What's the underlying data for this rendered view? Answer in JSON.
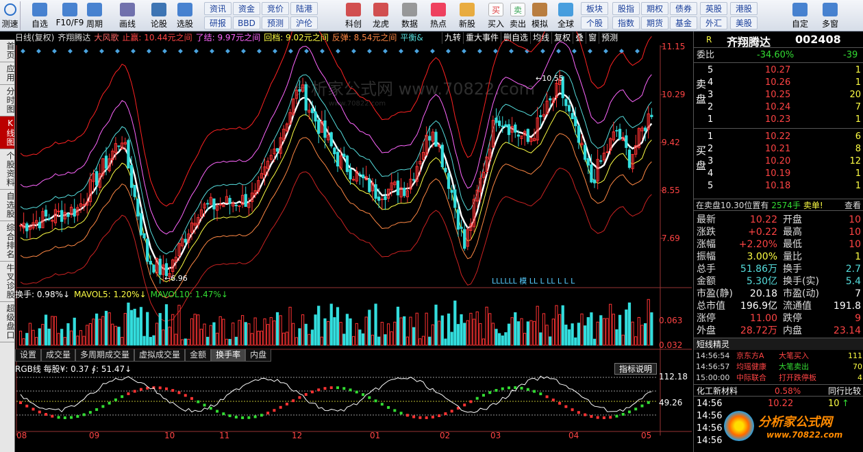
{
  "toolbar": {
    "buttons": [
      {
        "label": "自选",
        "icon": "star-icon"
      },
      {
        "label": "F10/F9",
        "icon": "f10-icon"
      },
      {
        "label": "周期",
        "icon": "clock-icon"
      },
      {
        "label": "画线",
        "icon": "pencil-icon"
      },
      {
        "label": "论股",
        "icon": "forum-icon"
      },
      {
        "label": "选股",
        "icon": "stock-picker-icon"
      },
      {
        "label": "科创",
        "icon": "kechuang-icon"
      },
      {
        "label": "龙虎",
        "icon": "dragon-tiger-icon"
      },
      {
        "label": "数据",
        "icon": "pe-data-icon"
      },
      {
        "label": "热点",
        "icon": "hotspot-icon"
      },
      {
        "label": "新股",
        "icon": "ipo-icon"
      },
      {
        "label": "买入",
        "icon": "buy-icon"
      },
      {
        "label": "卖出",
        "icon": "sell-icon"
      },
      {
        "label": "模拟",
        "icon": "hammer-icon"
      },
      {
        "label": "全球",
        "icon": "globe-icon"
      },
      {
        "label": "自定",
        "icon": "custom-icon"
      },
      {
        "label": "多窗",
        "icon": "multi-window-icon"
      }
    ],
    "mini_row1": [
      "资讯",
      "资金",
      "竞价",
      "陆港",
      "板块",
      "股指",
      "期权",
      "债券",
      "英股",
      "港股"
    ],
    "mini_row2": [
      "研报",
      "BBD",
      "预测",
      "沪伦",
      "个股",
      "指数",
      "期货",
      "基金",
      "外汇",
      "美股"
    ],
    "corner_label": "测速",
    "buy_glyph": "买",
    "sell_glyph": "卖"
  },
  "sidebar": {
    "tabs": [
      "首页",
      "应用",
      "分时图",
      "K线图",
      "个股资料",
      "自选股",
      "综合排名",
      "牛叉诊股",
      "超级盘口"
    ],
    "active": "K线图"
  },
  "chart": {
    "info": [
      {
        "text": "日线(复权)",
        "color": "#dddddd"
      },
      {
        "text": "齐翔腾达",
        "color": "#dddddd"
      },
      {
        "text": "大风歌",
        "color": "#ff6666"
      },
      {
        "text": "止赢: 10.44元之间",
        "color": "#ff4444"
      },
      {
        "text": "了结: 9.97元之间",
        "color": "#ff66ff"
      },
      {
        "text": "回档: 9.02元之间",
        "color": "#ffff44"
      },
      {
        "text": "反弹: 8.54元之间",
        "color": "#ff8844"
      },
      {
        "text": "平衡&",
        "color": "#55dddd"
      }
    ],
    "tools": [
      "九转",
      "重大事件",
      "删自选",
      "均线",
      "复权",
      "叠",
      "窗",
      "预测"
    ],
    "price_axis": [
      "11.15",
      "10.29",
      "9.42",
      "8.55",
      "7.69"
    ],
    "high_mark": "10.55",
    "low_mark": "6.96",
    "watermark": "分析家公式网 www.70822.com",
    "watermark_sub": "www.70822.com",
    "event_marks": "LLLLLL 模 LL L    LL L  L L"
  },
  "volume": {
    "info": [
      {
        "text": "换手: 0.98%↓",
        "color": "#ffffff"
      },
      {
        "text": "MAVOL5: 1.20%↓",
        "color": "#ffff44"
      },
      {
        "text": "MAVOL10: 1.47%↓",
        "color": "#33dd33"
      }
    ],
    "axis": [
      "0.063",
      "0.032"
    ]
  },
  "subtabs": {
    "items": [
      "设置",
      "成交量",
      "多周期成交量",
      "虚拟成交量",
      "金额",
      "换手率",
      "内盘"
    ],
    "active": "换手率"
  },
  "indicator": {
    "info": "RGB线 每股¥: 0.37  ∮: 51.47↓",
    "help_label": "指标说明",
    "axis": [
      "112.18",
      "49.26"
    ]
  },
  "time_axis": [
    "08",
    "09",
    "10",
    "11",
    "12",
    "01",
    "02",
    "03",
    "04",
    "05"
  ],
  "right_panel": {
    "stock_name": "齐翔腾达",
    "stock_code": "002408",
    "webi_label": "委比",
    "webi_value": "-34.60%",
    "webi_diff": "-39",
    "sell_label": [
      "卖",
      "盘"
    ],
    "buy_label": [
      "买",
      "盘"
    ],
    "sell": [
      {
        "n": "5",
        "p": "10.27",
        "v": "1"
      },
      {
        "n": "4",
        "p": "10.26",
        "v": "1"
      },
      {
        "n": "3",
        "p": "10.25",
        "v": "20"
      },
      {
        "n": "2",
        "p": "10.24",
        "v": "7"
      },
      {
        "n": "1",
        "p": "10.23",
        "v": "1"
      }
    ],
    "buy": [
      {
        "n": "1",
        "p": "10.22",
        "v": "6"
      },
      {
        "n": "2",
        "p": "10.21",
        "v": "8"
      },
      {
        "n": "3",
        "p": "10.20",
        "v": "12"
      },
      {
        "n": "4",
        "p": "10.19",
        "v": "1"
      },
      {
        "n": "5",
        "p": "10.18",
        "v": "1"
      }
    ],
    "sell_msg": "在卖盘10.30位置有",
    "sell_msg_qty": "2574手",
    "sell_msg_tag": "卖单!",
    "sell_msg_more": "查看",
    "quotes": [
      {
        "l": "最新",
        "v": "10.22",
        "lc": "red",
        "r": "开盘",
        "rv": "10"
      },
      {
        "l": "涨跌",
        "v": "+0.22",
        "lc": "red",
        "r": "最高",
        "rv": "10"
      },
      {
        "l": "涨幅",
        "v": "+2.20%",
        "lc": "red",
        "r": "最低",
        "rv": "10"
      },
      {
        "l": "振幅",
        "v": "3.00%",
        "lc": "yellow",
        "r": "量比",
        "rv": "1"
      },
      {
        "l": "总手",
        "v": "51.86万",
        "lc": "cyan",
        "r": "换手",
        "rv": "2.7"
      },
      {
        "l": "金额",
        "v": "5.30亿",
        "lc": "cyan",
        "r": "换手(实)",
        "rv": "5.4"
      },
      {
        "l": "市盈(静)",
        "v": "20.18",
        "lc": "white",
        "r": "市盈(动)",
        "rv": "7"
      },
      {
        "l": "总市值",
        "v": "196.9亿",
        "lc": "white",
        "r": "流通值",
        "rv": "191.8"
      },
      {
        "l": "涨停",
        "v": "11.00",
        "lc": "red",
        "r": "跌停",
        "rv": "9"
      },
      {
        "l": "外盘",
        "v": "28.72万",
        "lc": "red",
        "r": "内盘",
        "rv": "23.14"
      }
    ],
    "short_title": "短线精灵",
    "short_items": [
      {
        "t": "14:56:54",
        "n": "京东方A",
        "e": "大笔买入",
        "v": "111",
        "c": "red"
      },
      {
        "t": "14:56:57",
        "n": "均瑶健康",
        "e": "大笔卖出",
        "v": "70",
        "c": "green"
      },
      {
        "t": "15:00:00",
        "n": "中际联合",
        "e": "打开跌停板",
        "v": "4",
        "c": "red"
      }
    ],
    "sector_name": "化工新材料",
    "sector_pct": "0.58%",
    "sector_tag": "同行比较",
    "ticks": [
      {
        "t": "14:56",
        "p": "10.22",
        "v": "10",
        "a": "↑"
      },
      {
        "t": "14:56",
        "p": "",
        "v": "",
        "a": ""
      },
      {
        "t": "14:56",
        "p": "",
        "v": "",
        "a": ""
      },
      {
        "t": "14:56",
        "p": "",
        "v": "",
        "a": ""
      }
    ],
    "logo_text": "分析家公式网",
    "logo_url": "www.70822.com"
  },
  "colors": {
    "up": "#ff3333",
    "down": "#33dddd",
    "bg": "#000000",
    "grid": "#660000"
  }
}
